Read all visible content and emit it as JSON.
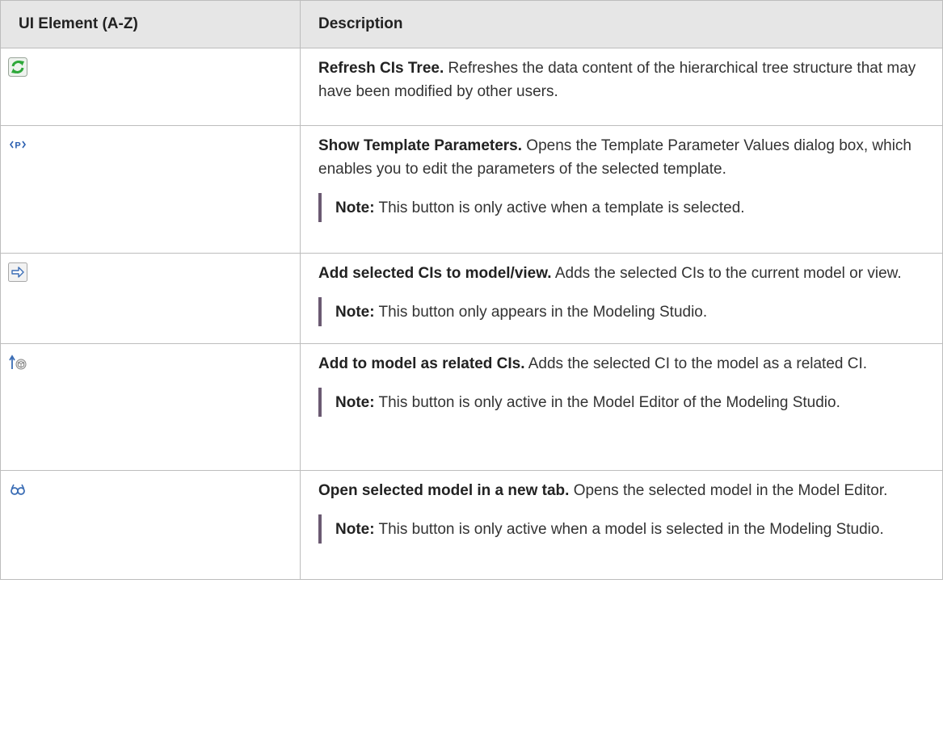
{
  "table": {
    "headers": [
      "UI Element (A-Z)",
      "Description"
    ],
    "rows": [
      {
        "icon": "refresh-icon",
        "title": "Refresh CIs Tree.",
        "text": " Refreshes the data content of the hierarchical tree structure that may have been modified by other users."
      },
      {
        "icon": "template-parameters-icon",
        "title": "Show Template Parameters.",
        "text": " Opens the Template Parameter Values dialog box, which enables you to edit the parameters of the selected template.",
        "note_label": "Note:",
        "note_text": "  This button is only active when a template is selected."
      },
      {
        "icon": "add-to-model-arrow-icon",
        "title": "Add selected CIs to model/view.",
        "text": " Adds the selected CIs to the current model or view.",
        "note_label": "Note:",
        "note_text": "  This button only appears in the Modeling Studio."
      },
      {
        "icon": "add-related-ci-icon",
        "title": "Add to model as related CIs.",
        "text": " Adds the selected CI to the model as a related CI.",
        "note_label": "Note:",
        "note_text": "  This button is only active in the Model Editor of the Modeling Studio."
      },
      {
        "icon": "open-model-new-tab-icon",
        "title": "Open selected model in a new tab.",
        "text": " Opens the selected model in the Model Editor.",
        "note_label": "Note:",
        "note_text": "  This button is only active when a model is selected in the Modeling Studio."
      }
    ]
  },
  "colors": {
    "header_bg": "#e6e6e6",
    "border": "#bdbdbd",
    "note_bar": "#6b5a72",
    "refresh_green": "#2ea83a"
  }
}
